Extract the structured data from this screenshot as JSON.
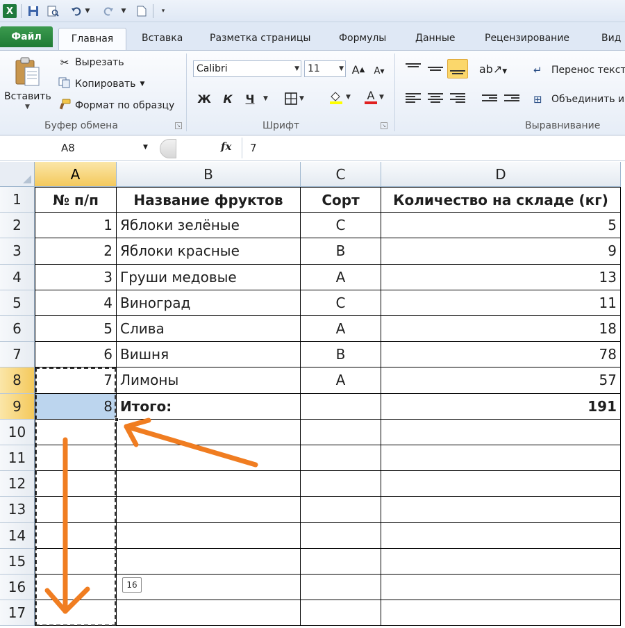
{
  "quick_access": {
    "logo": "X",
    "icons": [
      "save-icon",
      "print-preview-icon",
      "undo-icon",
      "redo-icon",
      "new-document-icon",
      "customize-icon"
    ]
  },
  "tabs": {
    "file": "Файл",
    "items": [
      "Главная",
      "Вставка",
      "Разметка страницы",
      "Формулы",
      "Данные",
      "Рецензирование",
      "Вид"
    ]
  },
  "ribbon": {
    "clipboard": {
      "paste": "Вставить",
      "cut": "Вырезать",
      "copy": "Копировать",
      "format_painter": "Формат по образцу",
      "group_label": "Буфер обмена"
    },
    "font": {
      "font_name": "Calibri",
      "font_size": "11",
      "bold": "Ж",
      "italic": "К",
      "underline": "Ч",
      "group_label": "Шрифт"
    },
    "alignment": {
      "wrap_text": "Перенос текст",
      "merge": "Объединить и",
      "group_label": "Выравнивание"
    }
  },
  "formula_bar": {
    "name_box": "A8",
    "fx": "fx",
    "formula": "7"
  },
  "sheet": {
    "columns": [
      "A",
      "B",
      "C",
      "D"
    ],
    "selected_column": "A",
    "row_numbers": [
      "1",
      "2",
      "3",
      "4",
      "5",
      "6",
      "7",
      "8",
      "9",
      "10",
      "11",
      "12",
      "13",
      "14",
      "15",
      "16",
      "17"
    ],
    "selected_rows": [
      "8",
      "9"
    ],
    "header": [
      "№ п/п",
      "Название фруктов",
      "Сорт",
      "Количество на складе (кг)"
    ],
    "rows": [
      [
        "1",
        "Яблоки зелёные",
        "C",
        "5"
      ],
      [
        "2",
        "Яблоки красные",
        "B",
        "9"
      ],
      [
        "3",
        "Груши медовые",
        "A",
        "13"
      ],
      [
        "4",
        "Виноград",
        "C",
        "11"
      ],
      [
        "5",
        "Слива",
        "A",
        "18"
      ],
      [
        "6",
        "Вишня",
        "B",
        "78"
      ],
      [
        "7",
        "Лимоны",
        "A",
        "57"
      ],
      [
        "8",
        "Итого:",
        "",
        "191"
      ]
    ],
    "autofill_tooltip": "16",
    "annotation_color": "#f07d21"
  }
}
